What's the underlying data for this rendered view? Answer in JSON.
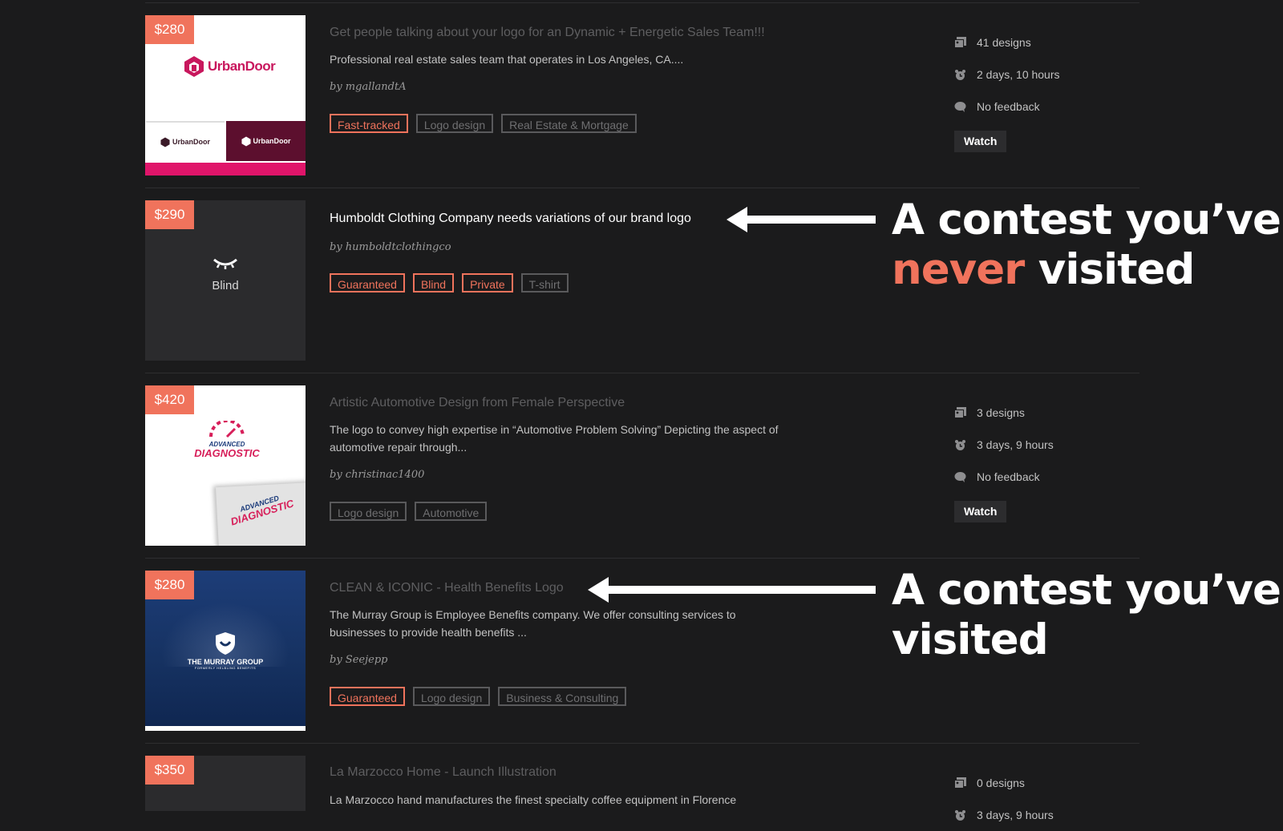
{
  "contests": [
    {
      "price": "$280",
      "title": "Get people talking about your logo for an Dynamic + Energetic Sales Team!!!",
      "description": "Professional real estate sales team that operates in Los Angeles, CA....",
      "author": "by mgallandtA",
      "tags": [
        {
          "label": "Fast-tracked",
          "style": "highlight"
        },
        {
          "label": "Logo design",
          "style": "plain"
        },
        {
          "label": "Real Estate & Mortgage",
          "style": "plain"
        }
      ],
      "stats": {
        "designs": "41 designs",
        "time_left": "2 days, 10 hours",
        "feedback": "No feedback"
      },
      "watch_label": "Watch",
      "thumb_brand": "UrbanDoor"
    },
    {
      "price": "$290",
      "title": "Humboldt Clothing Company needs variations of our brand logo",
      "author": "by humboldtclothingco",
      "tags": [
        {
          "label": "Guaranteed",
          "style": "highlight"
        },
        {
          "label": "Blind",
          "style": "highlight"
        },
        {
          "label": "Private",
          "style": "highlight"
        },
        {
          "label": "T-shirt",
          "style": "plain"
        }
      ],
      "thumb_label": "Blind"
    },
    {
      "price": "$420",
      "title": "Artistic Automotive Design from Female Perspective",
      "description": "The logo to convey high expertise in “Automotive Problem Solving” Depicting the aspect of automotive repair through...",
      "author": "by christinac1400",
      "tags": [
        {
          "label": "Logo design",
          "style": "plain"
        },
        {
          "label": "Automotive",
          "style": "plain"
        }
      ],
      "stats": {
        "designs": "3 designs",
        "time_left": "3 days, 9 hours",
        "feedback": "No feedback"
      },
      "watch_label": "Watch",
      "thumb_brand_small": "ADVANCED",
      "thumb_brand": "DIAGNOSTIC"
    },
    {
      "price": "$280",
      "title": "CLEAN & ICONIC - Health Benefits Logo",
      "description": "The Murray Group is Employee Benefits company. We offer consulting services to businesses to provide health benefits ...",
      "author": "by Seejepp",
      "tags": [
        {
          "label": "Guaranteed",
          "style": "highlight"
        },
        {
          "label": "Logo design",
          "style": "plain"
        },
        {
          "label": "Business & Consulting",
          "style": "plain"
        }
      ],
      "thumb_brand": "THE MURRAY GROUP",
      "thumb_tagline": "FORMERLY HELBLING BENEFITS"
    },
    {
      "price": "$350",
      "title": "La Marzocco Home - Launch Illustration",
      "description": "La Marzocco hand manufactures the finest specialty coffee equipment in Florence",
      "stats": {
        "designs": "0 designs",
        "time_left": "3 days, 9 hours"
      }
    }
  ],
  "annotations": {
    "never_line1": "A contest you’ve",
    "never_accent": "never",
    "never_rest": " visited",
    "visited_line1": "A contest you’ve",
    "visited_line2": "visited"
  },
  "colors": {
    "background": "#1b1b1c",
    "accent": "#f0735c",
    "visited_title": "#5e5e60",
    "unvisited_title": "#ffffff"
  },
  "icons": [
    "designs-icon",
    "clock-icon",
    "feedback-icon",
    "arrow-left-icon",
    "closed-eye-icon"
  ]
}
